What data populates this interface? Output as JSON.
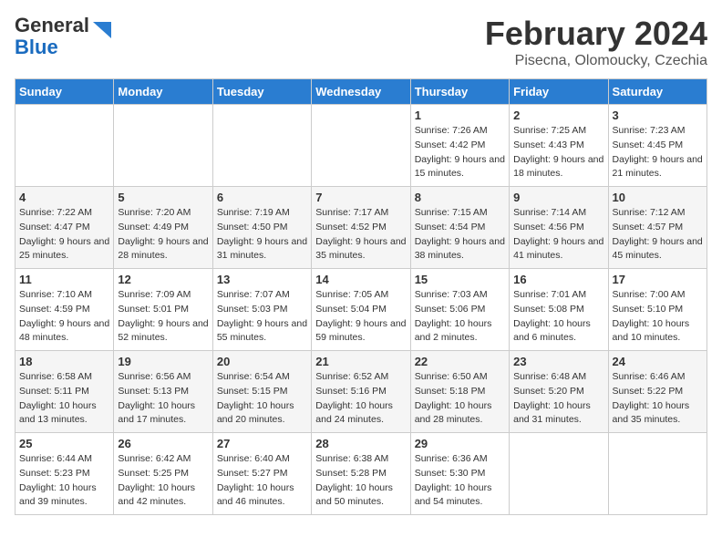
{
  "header": {
    "logo_line1": "General",
    "logo_line2": "Blue",
    "title": "February 2024",
    "subtitle": "Pisecna, Olomoucky, Czechia"
  },
  "weekdays": [
    "Sunday",
    "Monday",
    "Tuesday",
    "Wednesday",
    "Thursday",
    "Friday",
    "Saturday"
  ],
  "weeks": [
    [
      {
        "day": "",
        "sunrise": "",
        "sunset": "",
        "daylight": ""
      },
      {
        "day": "",
        "sunrise": "",
        "sunset": "",
        "daylight": ""
      },
      {
        "day": "",
        "sunrise": "",
        "sunset": "",
        "daylight": ""
      },
      {
        "day": "",
        "sunrise": "",
        "sunset": "",
        "daylight": ""
      },
      {
        "day": "1",
        "sunrise": "Sunrise: 7:26 AM",
        "sunset": "Sunset: 4:42 PM",
        "daylight": "Daylight: 9 hours and 15 minutes."
      },
      {
        "day": "2",
        "sunrise": "Sunrise: 7:25 AM",
        "sunset": "Sunset: 4:43 PM",
        "daylight": "Daylight: 9 hours and 18 minutes."
      },
      {
        "day": "3",
        "sunrise": "Sunrise: 7:23 AM",
        "sunset": "Sunset: 4:45 PM",
        "daylight": "Daylight: 9 hours and 21 minutes."
      }
    ],
    [
      {
        "day": "4",
        "sunrise": "Sunrise: 7:22 AM",
        "sunset": "Sunset: 4:47 PM",
        "daylight": "Daylight: 9 hours and 25 minutes."
      },
      {
        "day": "5",
        "sunrise": "Sunrise: 7:20 AM",
        "sunset": "Sunset: 4:49 PM",
        "daylight": "Daylight: 9 hours and 28 minutes."
      },
      {
        "day": "6",
        "sunrise": "Sunrise: 7:19 AM",
        "sunset": "Sunset: 4:50 PM",
        "daylight": "Daylight: 9 hours and 31 minutes."
      },
      {
        "day": "7",
        "sunrise": "Sunrise: 7:17 AM",
        "sunset": "Sunset: 4:52 PM",
        "daylight": "Daylight: 9 hours and 35 minutes."
      },
      {
        "day": "8",
        "sunrise": "Sunrise: 7:15 AM",
        "sunset": "Sunset: 4:54 PM",
        "daylight": "Daylight: 9 hours and 38 minutes."
      },
      {
        "day": "9",
        "sunrise": "Sunrise: 7:14 AM",
        "sunset": "Sunset: 4:56 PM",
        "daylight": "Daylight: 9 hours and 41 minutes."
      },
      {
        "day": "10",
        "sunrise": "Sunrise: 7:12 AM",
        "sunset": "Sunset: 4:57 PM",
        "daylight": "Daylight: 9 hours and 45 minutes."
      }
    ],
    [
      {
        "day": "11",
        "sunrise": "Sunrise: 7:10 AM",
        "sunset": "Sunset: 4:59 PM",
        "daylight": "Daylight: 9 hours and 48 minutes."
      },
      {
        "day": "12",
        "sunrise": "Sunrise: 7:09 AM",
        "sunset": "Sunset: 5:01 PM",
        "daylight": "Daylight: 9 hours and 52 minutes."
      },
      {
        "day": "13",
        "sunrise": "Sunrise: 7:07 AM",
        "sunset": "Sunset: 5:03 PM",
        "daylight": "Daylight: 9 hours and 55 minutes."
      },
      {
        "day": "14",
        "sunrise": "Sunrise: 7:05 AM",
        "sunset": "Sunset: 5:04 PM",
        "daylight": "Daylight: 9 hours and 59 minutes."
      },
      {
        "day": "15",
        "sunrise": "Sunrise: 7:03 AM",
        "sunset": "Sunset: 5:06 PM",
        "daylight": "Daylight: 10 hours and 2 minutes."
      },
      {
        "day": "16",
        "sunrise": "Sunrise: 7:01 AM",
        "sunset": "Sunset: 5:08 PM",
        "daylight": "Daylight: 10 hours and 6 minutes."
      },
      {
        "day": "17",
        "sunrise": "Sunrise: 7:00 AM",
        "sunset": "Sunset: 5:10 PM",
        "daylight": "Daylight: 10 hours and 10 minutes."
      }
    ],
    [
      {
        "day": "18",
        "sunrise": "Sunrise: 6:58 AM",
        "sunset": "Sunset: 5:11 PM",
        "daylight": "Daylight: 10 hours and 13 minutes."
      },
      {
        "day": "19",
        "sunrise": "Sunrise: 6:56 AM",
        "sunset": "Sunset: 5:13 PM",
        "daylight": "Daylight: 10 hours and 17 minutes."
      },
      {
        "day": "20",
        "sunrise": "Sunrise: 6:54 AM",
        "sunset": "Sunset: 5:15 PM",
        "daylight": "Daylight: 10 hours and 20 minutes."
      },
      {
        "day": "21",
        "sunrise": "Sunrise: 6:52 AM",
        "sunset": "Sunset: 5:16 PM",
        "daylight": "Daylight: 10 hours and 24 minutes."
      },
      {
        "day": "22",
        "sunrise": "Sunrise: 6:50 AM",
        "sunset": "Sunset: 5:18 PM",
        "daylight": "Daylight: 10 hours and 28 minutes."
      },
      {
        "day": "23",
        "sunrise": "Sunrise: 6:48 AM",
        "sunset": "Sunset: 5:20 PM",
        "daylight": "Daylight: 10 hours and 31 minutes."
      },
      {
        "day": "24",
        "sunrise": "Sunrise: 6:46 AM",
        "sunset": "Sunset: 5:22 PM",
        "daylight": "Daylight: 10 hours and 35 minutes."
      }
    ],
    [
      {
        "day": "25",
        "sunrise": "Sunrise: 6:44 AM",
        "sunset": "Sunset: 5:23 PM",
        "daylight": "Daylight: 10 hours and 39 minutes."
      },
      {
        "day": "26",
        "sunrise": "Sunrise: 6:42 AM",
        "sunset": "Sunset: 5:25 PM",
        "daylight": "Daylight: 10 hours and 42 minutes."
      },
      {
        "day": "27",
        "sunrise": "Sunrise: 6:40 AM",
        "sunset": "Sunset: 5:27 PM",
        "daylight": "Daylight: 10 hours and 46 minutes."
      },
      {
        "day": "28",
        "sunrise": "Sunrise: 6:38 AM",
        "sunset": "Sunset: 5:28 PM",
        "daylight": "Daylight: 10 hours and 50 minutes."
      },
      {
        "day": "29",
        "sunrise": "Sunrise: 6:36 AM",
        "sunset": "Sunset: 5:30 PM",
        "daylight": "Daylight: 10 hours and 54 minutes."
      },
      {
        "day": "",
        "sunrise": "",
        "sunset": "",
        "daylight": ""
      },
      {
        "day": "",
        "sunrise": "",
        "sunset": "",
        "daylight": ""
      }
    ]
  ]
}
